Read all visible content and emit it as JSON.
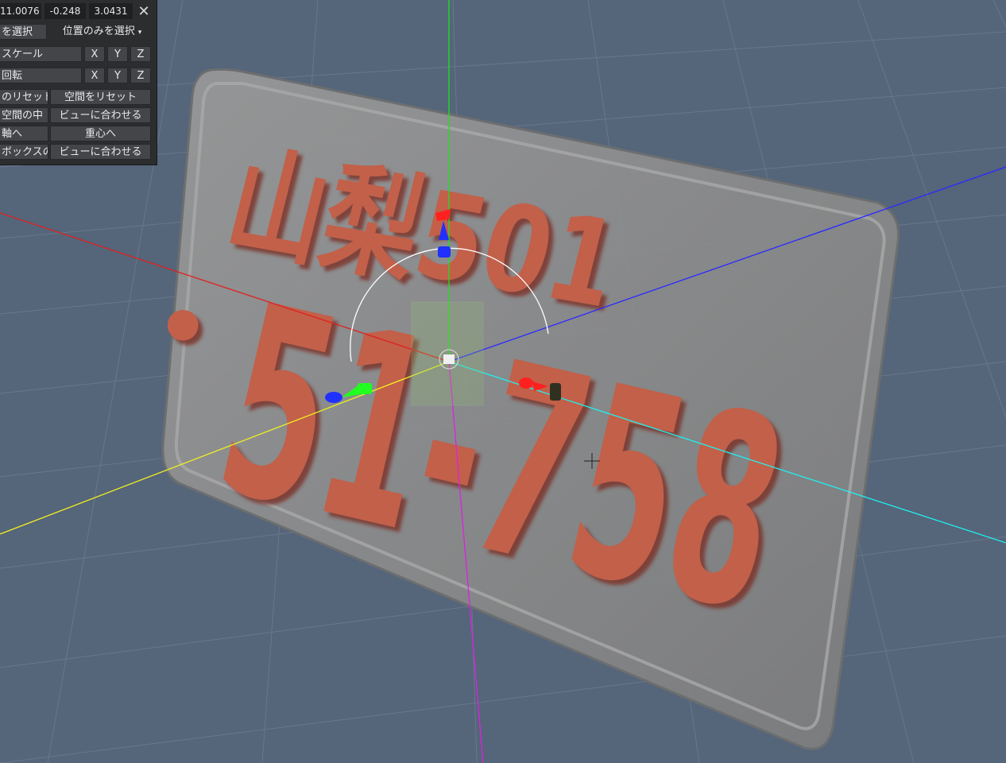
{
  "coords": {
    "x": "11.0076",
    "y": "-0.248",
    "z": "3.0431"
  },
  "close_glyph": "✕",
  "select": {
    "left": "を選択",
    "dropdown": "位置のみを選択",
    "caret": "▾"
  },
  "scale": {
    "label": "スケール",
    "x": "X",
    "y": "Y",
    "z": "Z"
  },
  "rotate": {
    "label": "回転",
    "x": "X",
    "y": "Y",
    "z": "Z"
  },
  "buttons": {
    "reset_left": "のリセット",
    "reset_space": "空間をリセット",
    "space_center": "空間の中",
    "fit_view_1": "ビューに合わせる",
    "to_axis": "軸へ",
    "to_centroid": "重心へ",
    "box": "ボックスの",
    "fit_view_2": "ビューに合わせる"
  },
  "plate": {
    "top_text": "山梨501",
    "bottom_text": "51-758",
    "dot": "•"
  },
  "colors": {
    "background": "#55657a",
    "grid": "#6c7a8c",
    "plate": "#8c8c8c",
    "lettering": "#c2604a",
    "axis_x": "#e02020",
    "axis_y": "#20e020",
    "axis_z": "#2020ff",
    "axis_yellow": "#ffff20",
    "axis_cyan": "#20ffff",
    "axis_magenta": "#e020e0"
  }
}
